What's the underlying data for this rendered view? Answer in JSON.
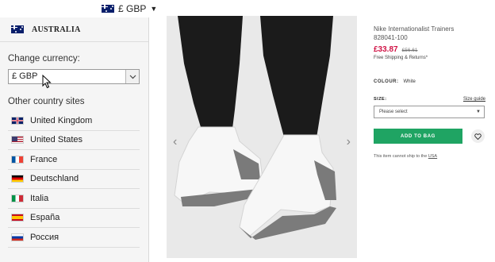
{
  "header": {
    "currency_toggle": "£ GBP"
  },
  "panel": {
    "country": "AUSTRALIA",
    "change_currency_label": "Change currency:",
    "currency_value": "£ GBP",
    "other_sites_label": "Other country sites",
    "countries": [
      {
        "name": "United Kingdom",
        "flag": "flag-uk-icon"
      },
      {
        "name": "United States",
        "flag": "flag-us-icon"
      },
      {
        "name": "France",
        "flag": "flag-fr-icon"
      },
      {
        "name": "Deutschland",
        "flag": "flag-de-icon"
      },
      {
        "name": "Italia",
        "flag": "flag-it-icon"
      },
      {
        "name": "España",
        "flag": "flag-es-icon"
      },
      {
        "name": "Россия",
        "flag": "flag-ru-icon"
      }
    ]
  },
  "product": {
    "name": "Nike Internationalist Trainers",
    "code": "828041-100",
    "price": "£33.87",
    "old_price": "£56.61",
    "shipping_link": "Free Shipping & Returns*",
    "colour_label": "COLOUR:",
    "colour_value": "White",
    "size_label": "SIZE:",
    "size_guide": "Size guide",
    "size_placeholder": "Please select",
    "add_to_bag": "ADD TO BAG",
    "ship_note_prefix": "This item cannot ship to the ",
    "ship_note_link": "USA"
  },
  "colors": {
    "price": "#d01345",
    "add_to_bag": "#1fa463"
  }
}
